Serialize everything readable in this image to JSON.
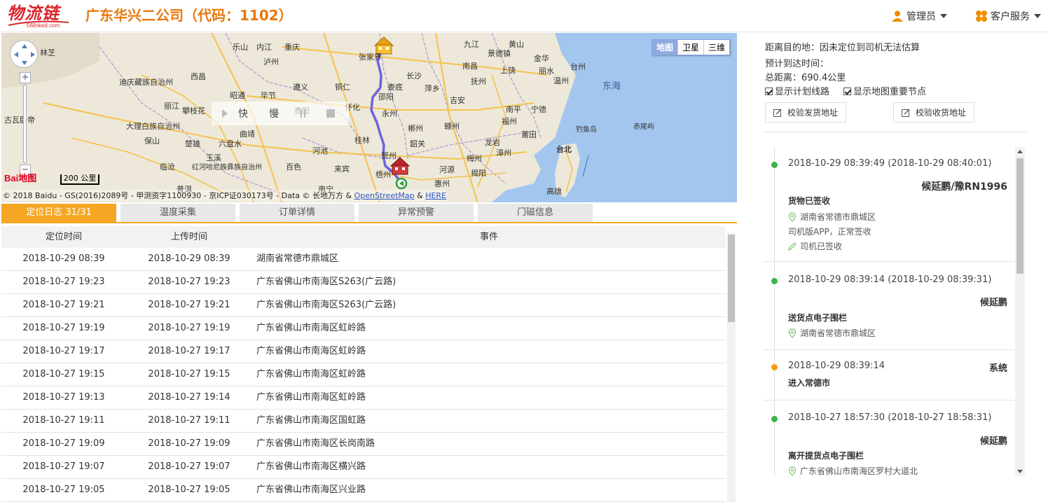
{
  "header": {
    "logo_text": "物流链",
    "logo_sub": "56linked.com",
    "company": "广东华兴二公司（代码：1102）",
    "admin_label": "管理员",
    "service_label": "客户服务"
  },
  "map": {
    "type_buttons": [
      "地图",
      "卫星",
      "三维"
    ],
    "active_type": "地图",
    "scale_label": "200 公里",
    "baidu_logo": "Bai地图",
    "copyright_prefix": "© 2018 Baidu - GS(2016)2089号 - 甲测资字1100930 - 京ICP证030173号 - Data © 长地万方 & ",
    "copyright_osm": "OpenStreetMap",
    "copyright_and": " & ",
    "copyright_here": "HERE",
    "play_fast": "快",
    "play_slow": "慢",
    "labels": [
      "林芝",
      "乐山",
      "内江",
      "重庆",
      "九江",
      "黄山",
      "张家界",
      "景德镇",
      "泸州",
      "南昌",
      "迪庆藏族自治州",
      "西昌",
      "遵义",
      "长沙",
      "金华",
      "丽江",
      "昭通",
      "毕节",
      "铜仁",
      "邵阳",
      "娄底",
      "萍乡",
      "抚州",
      "丽水",
      "温州",
      "台州",
      "东海",
      "攀枝花",
      "贵阳",
      "怀化",
      "吉安",
      "南平",
      "宁德",
      "古瓦卧帝",
      "大理白族自治州",
      "曲靖",
      "永州",
      "郴州",
      "赣州",
      "福州",
      "钓鱼岛",
      "赤尾屿",
      "保山",
      "楚雄",
      "六盘水",
      "桂林",
      "莆田",
      "玉溪",
      "河池",
      "贺州",
      "梅州",
      "漳州",
      "临沧",
      "红河哈尼族彝族自治州",
      "百色",
      "来宾",
      "梧州",
      "河源",
      "揭阳",
      "台北",
      "普洱",
      "南宁",
      "惠州",
      "高雄",
      "韶关",
      "龙岩",
      "上饶"
    ]
  },
  "tabs": [
    "定位日志 31/31",
    "温度采集",
    "订单详情",
    "异常预警",
    "门磁信息"
  ],
  "table": {
    "headers": [
      "定位时间",
      "上传时间",
      "事件"
    ],
    "rows": [
      [
        "2018-10-29 08:39",
        "2018-10-29 08:39",
        "湖南省常德市鼎城区"
      ],
      [
        "2018-10-27 19:23",
        "2018-10-27 19:23",
        "广东省佛山市南海区S263(广云路)"
      ],
      [
        "2018-10-27 19:21",
        "2018-10-27 19:21",
        "广东省佛山市南海区S263(广云路)"
      ],
      [
        "2018-10-27 19:19",
        "2018-10-27 19:19",
        "广东省佛山市南海区虹岭路"
      ],
      [
        "2018-10-27 19:17",
        "2018-10-27 19:17",
        "广东省佛山市南海区虹岭路"
      ],
      [
        "2018-10-27 19:15",
        "2018-10-27 19:15",
        "广东省佛山市南海区虹岭路"
      ],
      [
        "2018-10-27 19:13",
        "2018-10-27 19:14",
        "广东省佛山市南海区虹岭路"
      ],
      [
        "2018-10-27 19:11",
        "2018-10-27 19:11",
        "广东省佛山市南海区国虹路"
      ],
      [
        "2018-10-27 19:09",
        "2018-10-27 19:09",
        "广东省佛山市南海区长岗南路"
      ],
      [
        "2018-10-27 19:07",
        "2018-10-27 19:07",
        "广东省佛山市南海区横兴路"
      ],
      [
        "2018-10-27 19:05",
        "2018-10-27 19:05",
        "广东省佛山市南海区兴业路"
      ]
    ]
  },
  "panel": {
    "distance": "距离目的地：因未定位到司机无法估算",
    "eta": "预计到达时间：",
    "total": "总距离：690.4公里",
    "show_route": "显示计划线路",
    "show_nodes": "显示地图重要节点",
    "btn_send": "校验发货地址",
    "btn_recv": "校验收货地址"
  },
  "timeline": [
    {
      "time": "2018-10-29 08:39:49 (2018-10-29 08:40:01)",
      "who": "候延鹏/豫RN1996",
      "title": "货物已签收",
      "location": "湖南省常德市鼎城区",
      "note": "司机版APP，正常签收",
      "sign": "司机已签收",
      "color": "#3bb54a"
    },
    {
      "time": "2018-10-29 08:39:14 (2018-10-29 08:39:31)",
      "who": "候延鹏",
      "title": "送货点电子围栏",
      "location": "湖南省常德市鼎城区",
      "color": "#3bb54a"
    },
    {
      "time": "2018-10-29 08:39:14",
      "who": "系统",
      "title": "进入常德市",
      "color": "#f39c12"
    },
    {
      "time": "2018-10-27 18:57:30 (2018-10-27 18:58:31)",
      "who": "候延鹏",
      "title": "离开提货点电子围栏",
      "location": "广东省佛山市南海区罗村大道北",
      "color": "#3bb54a"
    }
  ]
}
